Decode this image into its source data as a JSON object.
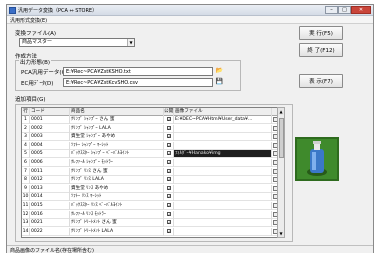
{
  "window": {
    "title": "汎用データ変換（PCA ⇔ STORE）"
  },
  "menu": {
    "item": "汎用形式変換(E)"
  },
  "conversion_file": {
    "label": "変換ファイル(A)",
    "selected": "商品マスター"
  },
  "buttons": {
    "run": "実 行(F5)",
    "exit": "終 了(F12)",
    "display": "表 示(F7)"
  },
  "method": {
    "group_label": "作成方法",
    "output_label": "出力形態(B)",
    "pca_label": "PCA汎用データ(C)",
    "pca_path": "E:¥Rec~PCA¥ZstKSHO.txt",
    "ec_label": "EC用ﾃﾞｰﾀ(D)",
    "ec_path": "E:¥Rec~PCA¥ZstKcvSHO.csv"
  },
  "item_list": {
    "label": "追加項目(G)",
    "columns": [
      "行",
      "コード",
      "商品名",
      "公開",
      "画像ファイル"
    ],
    "rows": [
      {
        "no": "1",
        "code": "0001",
        "name": "ｸﾘﾝﾌﾟ ｼｬﾝﾌﾟｰ さん 蜜",
        "pub": "✓",
        "file": "E:¥DEC~PCA¥Html¥User_data¥..."
      },
      {
        "no": "2",
        "code": "0002",
        "name": "ｸﾘﾝﾌﾟ ｼｬﾝﾌﾟｰ LALA",
        "pub": "✓",
        "file": ""
      },
      {
        "no": "3",
        "code": "0003",
        "name": "資生堂 ｼｬﾝﾌﾟｰ あやめ",
        "pub": "✓",
        "file": ""
      },
      {
        "no": "4",
        "code": "0004",
        "name": "ｿﾌﾄｰ ｼｬﾝﾌﾟｰ ﾏｰｼｯﾄ",
        "pub": "✓",
        "file": ""
      },
      {
        "no": "5",
        "code": "0005",
        "name": "ﾊﾞｯｸｽｽﾀｰ ｼｬﾝﾌﾟｰ ﾍﾞｰﾊﾞﾙﾖｲﾝﾄ",
        "pub": "✓",
        "file": "ﾌｫﾙﾀﾞｰ¥Hanako¥img"
      },
      {
        "no": "6",
        "code": "0006",
        "name": "ｸﾚﾌｧｰﾙ ｼｬﾝﾌﾟｰ ﾓｯﾄﾗｰ",
        "pub": "✓",
        "file": ""
      },
      {
        "no": "7",
        "code": "0011",
        "name": "ｸﾘﾝﾌﾟ ﾘﾝｽ さん 蜜",
        "pub": "✓",
        "file": ""
      },
      {
        "no": "8",
        "code": "0012",
        "name": "ｸﾘﾝﾌﾟ ﾘﾝｽ LALA",
        "pub": "✓",
        "file": ""
      },
      {
        "no": "9",
        "code": "0013",
        "name": "資生堂 ﾘﾝｽ あやめ",
        "pub": "✓",
        "file": ""
      },
      {
        "no": "10",
        "code": "0014",
        "name": "ｿﾌﾄｰ ﾘﾝｽ ﾏｰｼｯﾄ",
        "pub": "✓",
        "file": ""
      },
      {
        "no": "11",
        "code": "0015",
        "name": "ﾊﾞｯｸｽｽﾀｰ ﾘﾝｽ ﾍﾞｰﾊﾞﾙﾖｲﾝﾄ",
        "pub": "✓",
        "file": ""
      },
      {
        "no": "12",
        "code": "0016",
        "name": "ｸﾚﾌｧｰﾙ ﾘﾝｽ ﾓｯﾄﾗｰ",
        "pub": "✓",
        "file": ""
      },
      {
        "no": "13",
        "code": "0021",
        "name": "ｸﾘﾝﾌﾟ ﾄﾘｰﾄﾒﾝﾄ さん 蜜",
        "pub": "✓",
        "file": ""
      },
      {
        "no": "14",
        "code": "0022",
        "name": "ｸﾘﾝﾌﾟ ﾄﾘｰﾄﾒﾝﾄ LALA",
        "pub": "✓",
        "file": ""
      }
    ]
  },
  "status": {
    "text": "商品画像のファイル名(存在場所含む)"
  },
  "icons": {
    "browse": "folder-open-icon",
    "save": "save-disk-icon"
  },
  "colors": {
    "dark_cell": "#1e1e1e",
    "preview_bottle": "#3b78c8",
    "preview_bg": "#2e6b1e"
  }
}
